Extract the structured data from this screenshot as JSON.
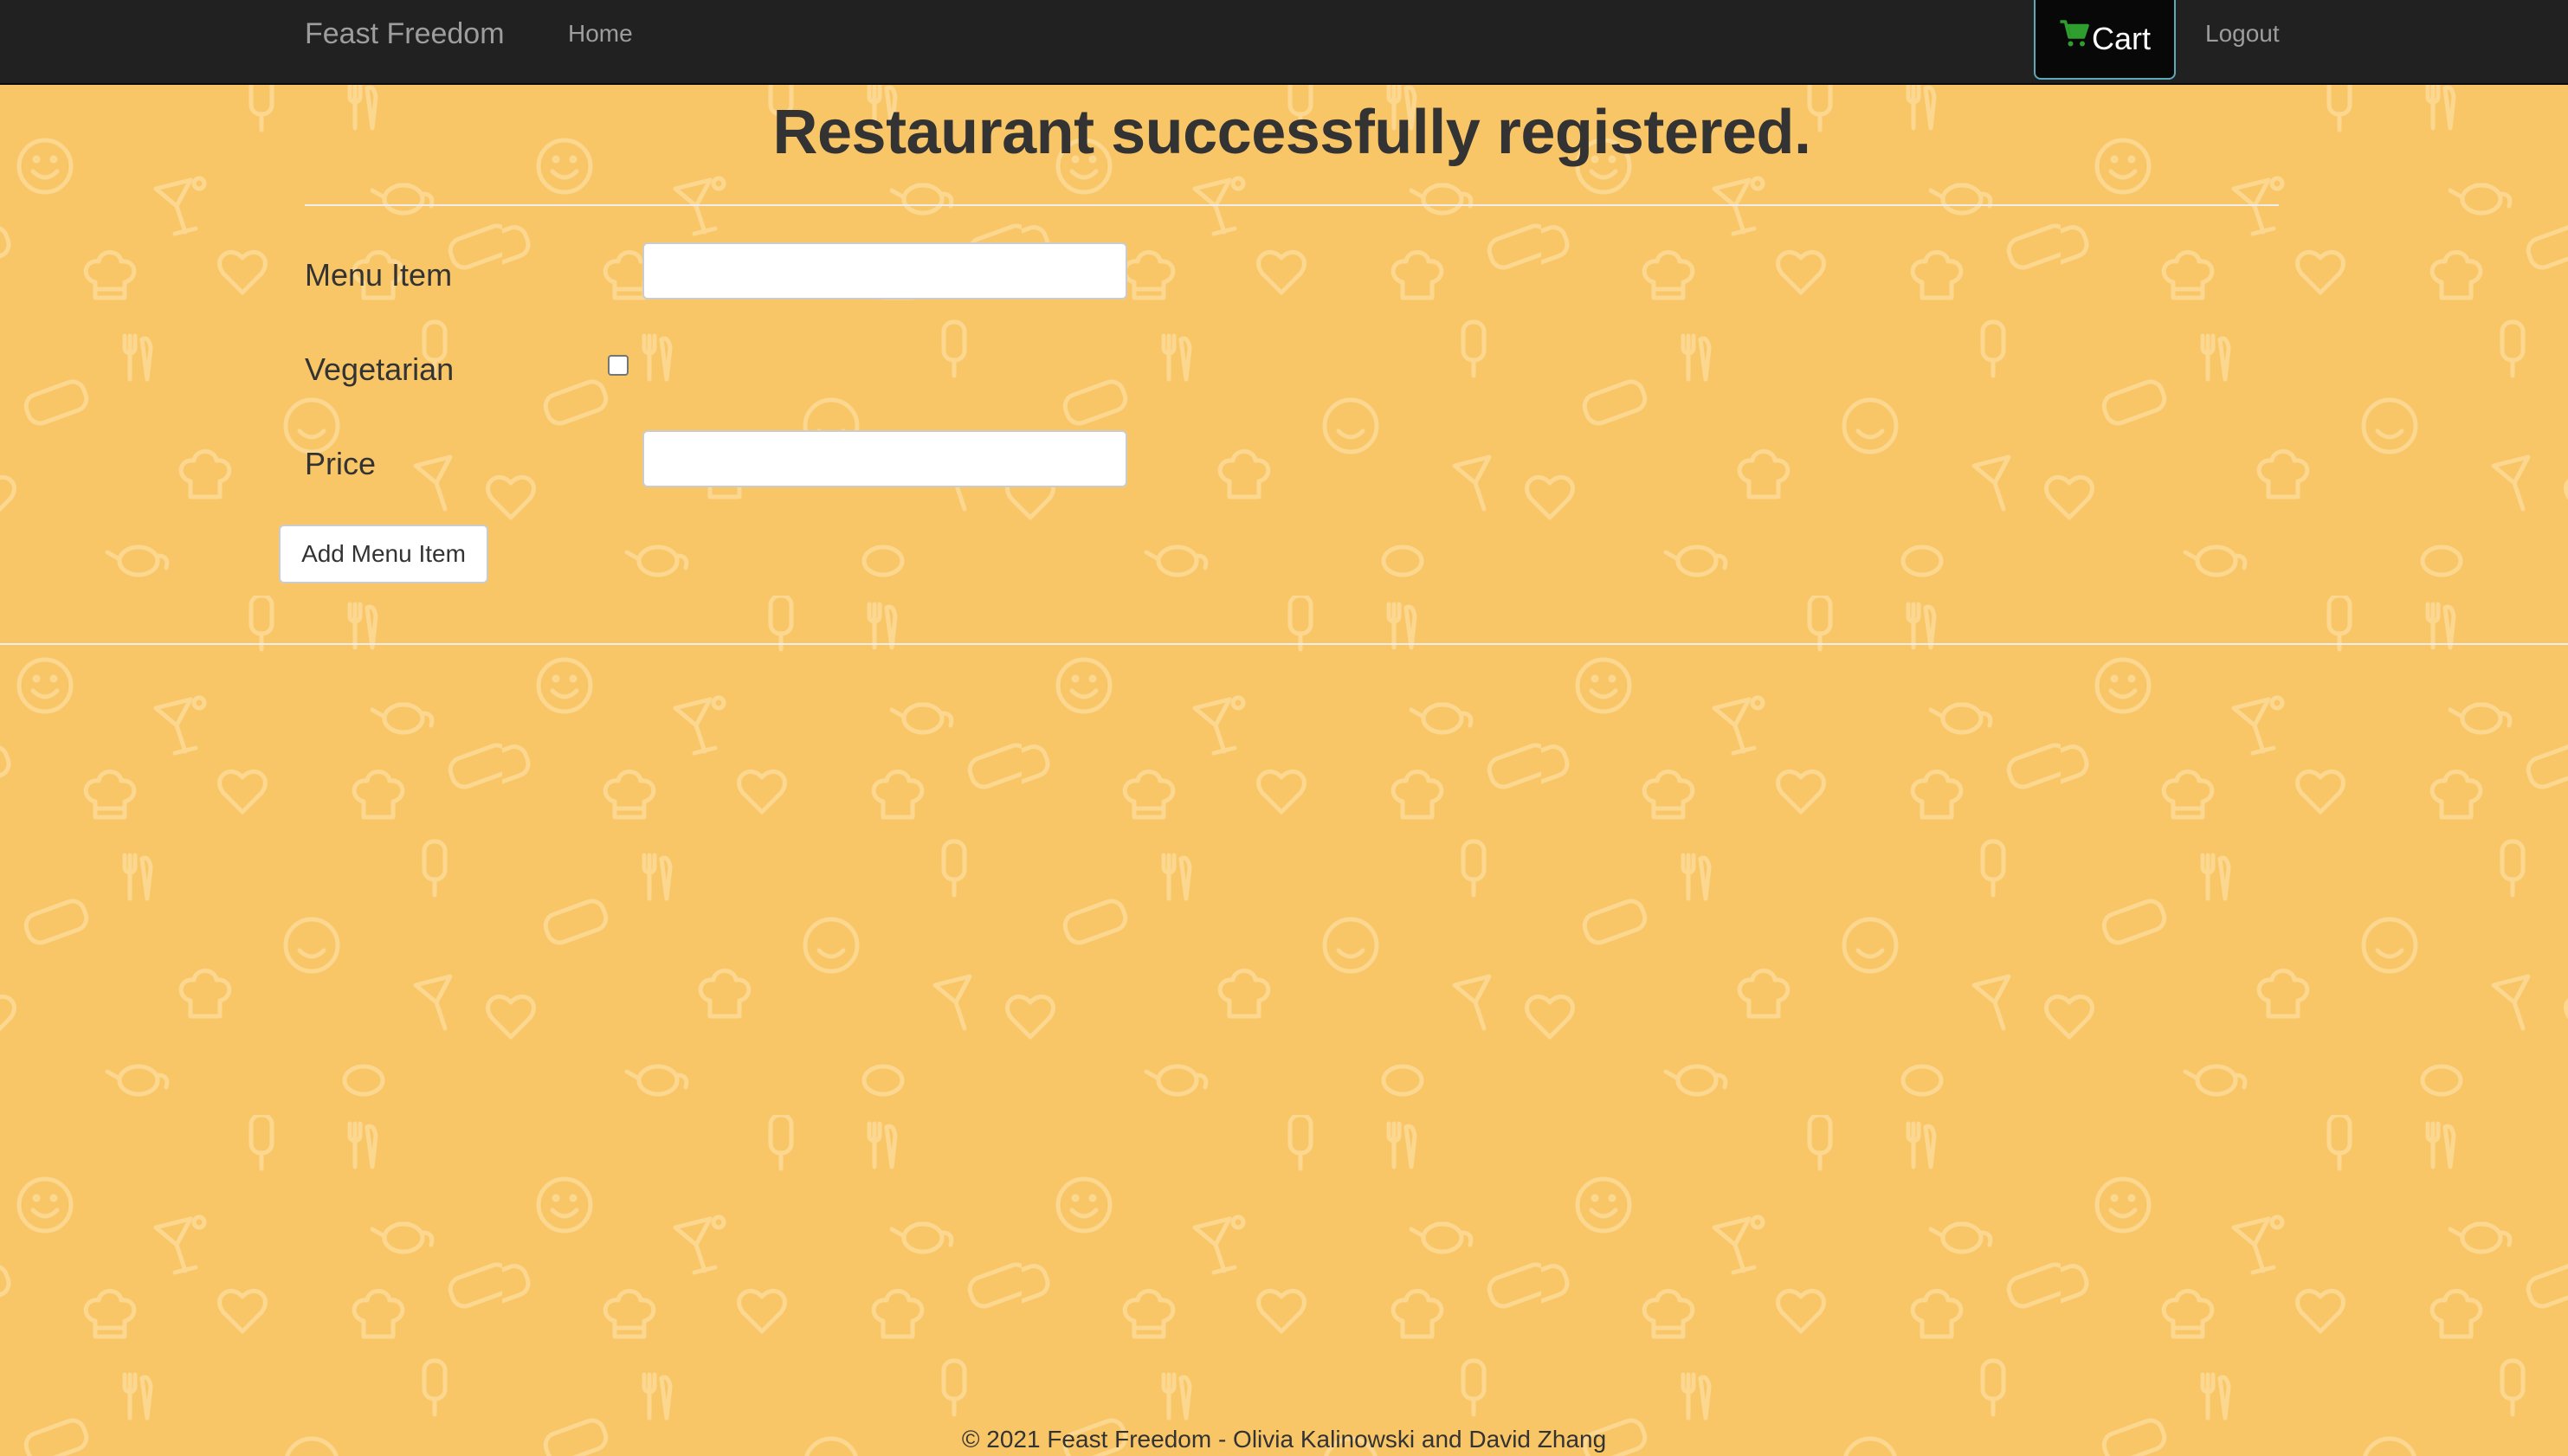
{
  "navbar": {
    "brand": "Feast Freedom",
    "home_label": "Home",
    "cart_label": "Cart",
    "logout_label": "Logout"
  },
  "main": {
    "heading": "Restaurant successfully registered.",
    "form": {
      "menu_item_label": "Menu Item",
      "menu_item_value": "",
      "vegetarian_label": "Vegetarian",
      "vegetarian_checked": false,
      "price_label": "Price",
      "price_value": "",
      "submit_label": "Add Menu Item"
    }
  },
  "footer": {
    "copyright": "© 2021 Feast Freedom - Olivia Kalinowski and David Zhang"
  },
  "theme": {
    "page_background": "#f9c667",
    "navbar_background": "#212121",
    "cart_icon_color": "#2e9e2e",
    "pattern_icons": [
      "popsicle-icon",
      "fork-knife-icon",
      "smiley-icon",
      "cocktail-icon",
      "teapot-icon",
      "sandwich-icon",
      "heart-icon",
      "chef-hat-icon"
    ]
  }
}
